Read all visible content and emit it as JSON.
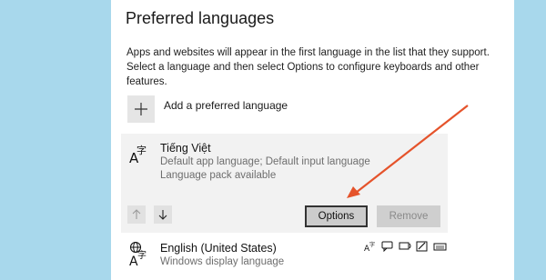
{
  "section": {
    "title": "Preferred languages",
    "description": "Apps and websites will appear in the first language in the list that they support. Select a language and then select Options to configure keyboards and other features."
  },
  "add_language": {
    "label": "Add a preferred language",
    "icon": "plus-icon"
  },
  "languages": [
    {
      "name": "Tiếng Việt",
      "details": [
        "Default app language; Default input language",
        "Language pack available"
      ],
      "icon": "language-icon",
      "selected": true
    },
    {
      "name": "English (United States)",
      "details": [
        "Windows display language"
      ],
      "icon": "language-globe-icon",
      "feature_icons": [
        "display-language-icon",
        "speech-icon",
        "text-to-speech-icon",
        "handwriting-icon",
        "keyboard-icon"
      ]
    }
  ],
  "buttons": {
    "options": "Options",
    "remove": "Remove",
    "move_up_icon": "arrow-up-icon",
    "move_down_icon": "arrow-down-icon"
  },
  "colors": {
    "side_background": "#a8d8ec",
    "selected_card": "#f2f2f2",
    "callout_arrow": "#e5532b"
  }
}
